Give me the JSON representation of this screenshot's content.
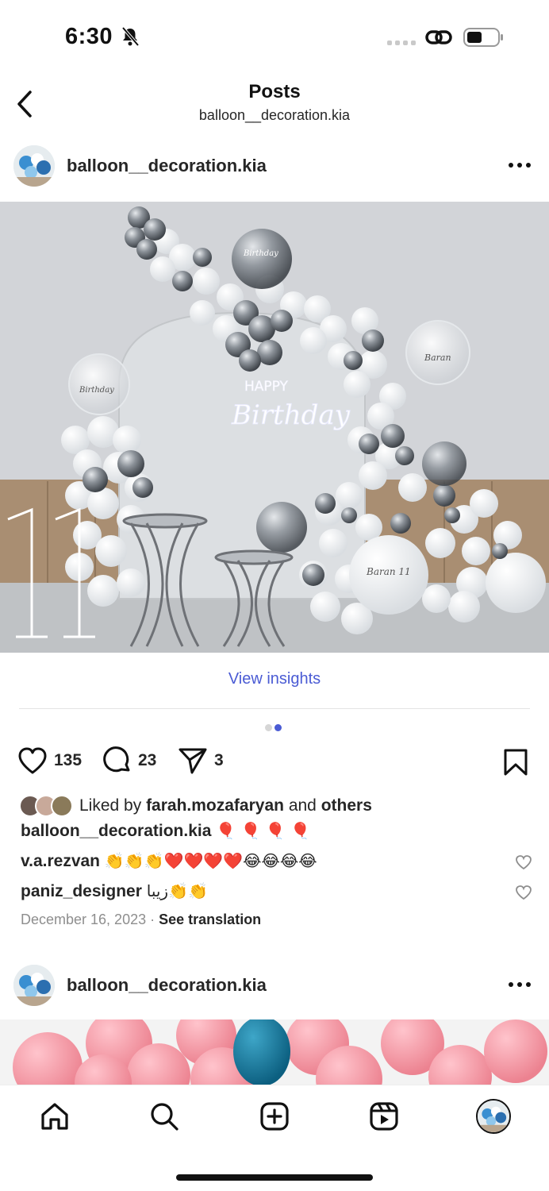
{
  "status": {
    "time": "6:30"
  },
  "nav": {
    "title": "Posts",
    "subtitle": "balloon__decoration.kia"
  },
  "post": {
    "username": "balloon__decoration.kia",
    "image_text": {
      "neon_top": "HAPPY",
      "neon_script": "Birthday",
      "big_balloon": "Baran 11",
      "clear_balloon_left": "Birthday",
      "clear_balloon_right": "Baran",
      "silver_balloon": "Birthday"
    },
    "view_insights": "View insights",
    "carousel": {
      "count": 2,
      "active": 2
    },
    "likes": "135",
    "comments": "23",
    "shares": "3",
    "liked_by": {
      "prefix": "Liked by",
      "user": "farah.mozafaryan",
      "and": "and",
      "others": "others"
    },
    "caption": {
      "username": "balloon__decoration.kia",
      "text": "🎈 🎈 🎈 🎈"
    },
    "comments_list": [
      {
        "username": "v.a.rezvan",
        "text": "👏👏👏❤️❤️❤️❤️😂😂😂😂"
      },
      {
        "username": "paniz_designer",
        "text": "زیبا👏👏"
      }
    ],
    "date": "December 16, 2023",
    "separator": "·",
    "see_translation": "See translation"
  },
  "post2": {
    "username": "balloon__decoration.kia"
  },
  "tabs": [
    "home-icon",
    "search-icon",
    "create-icon",
    "reels-icon",
    "profile-avatar"
  ],
  "colors": {
    "accent": "#4a5bd4",
    "text": "#262626",
    "muted": "#8e8e8e"
  }
}
